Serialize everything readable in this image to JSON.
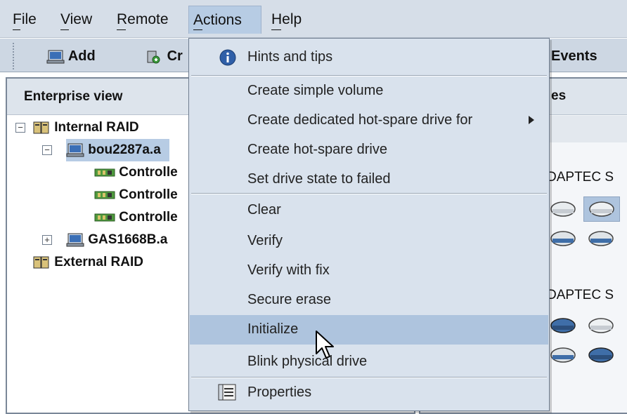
{
  "menubar": {
    "items": [
      "File",
      "View",
      "Remote",
      "Actions",
      "Help"
    ],
    "mnemonics": [
      "F",
      "V",
      "R",
      "A",
      "H"
    ]
  },
  "toolbar": {
    "add_label": "Add",
    "create_label": "Cr",
    "events_label": "Events"
  },
  "left_panel": {
    "header": "Enterprise view",
    "tree": {
      "internal_raid": "Internal RAID",
      "server1": "bou2287a.a",
      "controllers": [
        "Controlle",
        "Controlle",
        "Controlle"
      ],
      "server2": "GAS1668B.a",
      "external_raid": "External RAID"
    }
  },
  "right_panel": {
    "header_partial": "es",
    "enclosure_labels": [
      "DAPTEC S",
      "DAPTEC S"
    ]
  },
  "actions_menu": {
    "items": [
      {
        "label": "Hints and tips",
        "icon": "info-icon"
      },
      {
        "label": "Create simple volume"
      },
      {
        "label": "Create dedicated hot-spare drive for",
        "submenu": true
      },
      {
        "label": "Create hot-spare drive"
      },
      {
        "label": "Set drive state to failed"
      },
      {
        "label": "Clear"
      },
      {
        "label": "Verify"
      },
      {
        "label": "Verify with fix"
      },
      {
        "label": "Secure erase"
      },
      {
        "label": "Initialize",
        "highlighted": true
      },
      {
        "label": "Blink physical drive"
      },
      {
        "label": "Properties",
        "icon": "properties-icon"
      }
    ]
  },
  "colors": {
    "menu_bg": "#d9e2ed",
    "highlight": "#aec4de",
    "menubar_bg": "#d6dee8"
  }
}
